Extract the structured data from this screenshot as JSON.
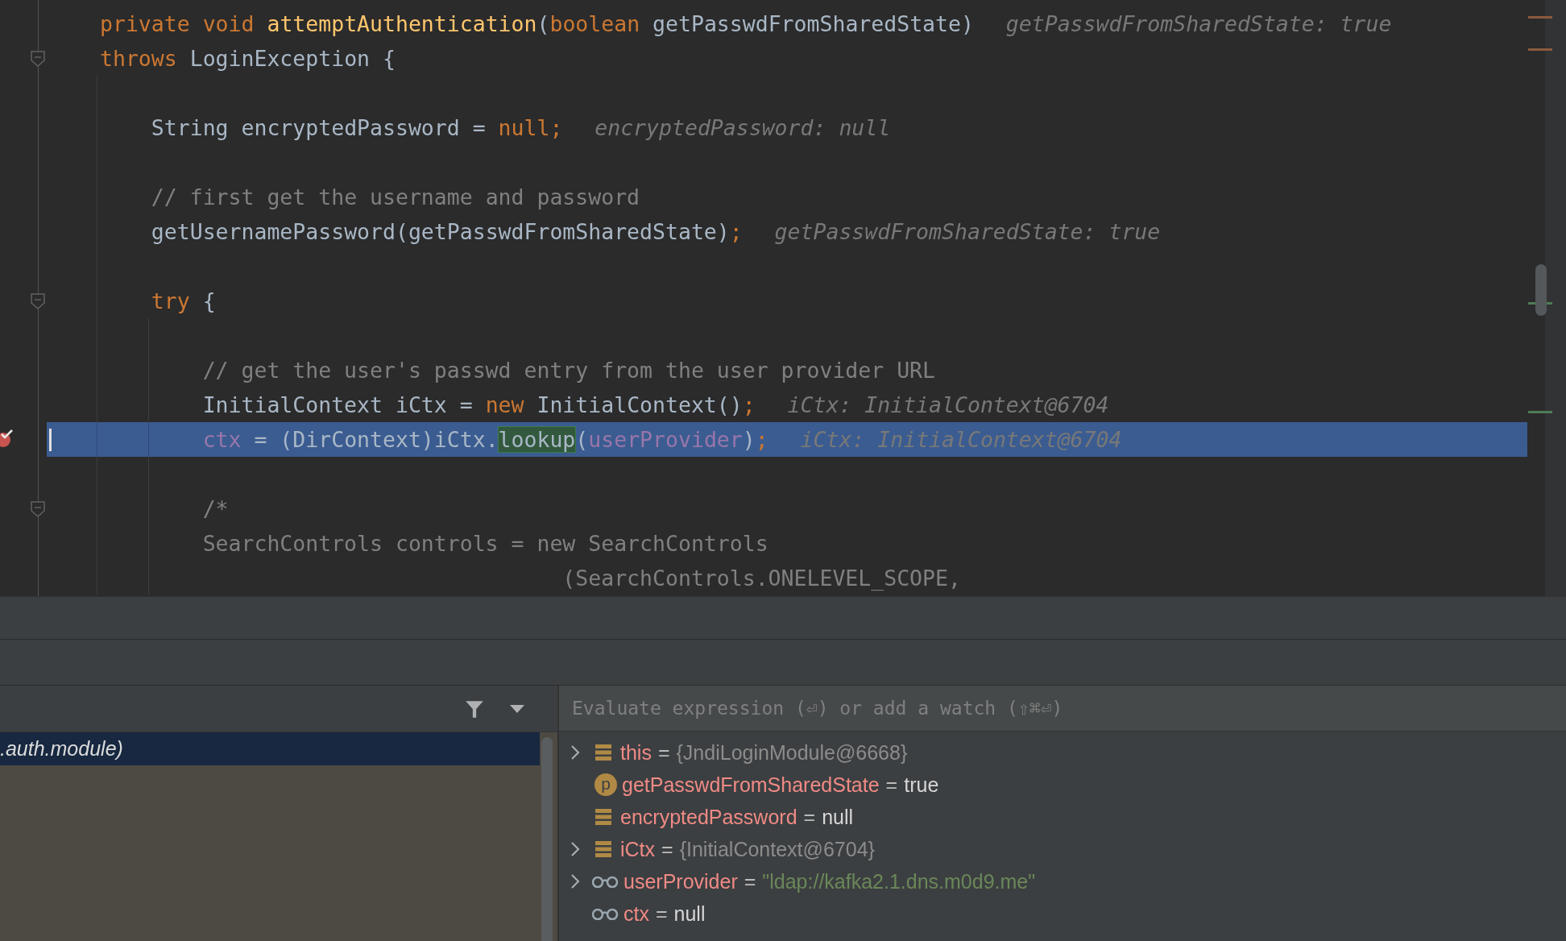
{
  "editor": {
    "lines": [
      {
        "kind": "code",
        "fold": false,
        "selected": false,
        "breakpoint": false,
        "tokens": [
          {
            "text": "private void ",
            "kind": "keyword"
          },
          {
            "text": "attemptAuthentication",
            "kind": "method"
          },
          {
            "text": "(",
            "kind": "plain"
          },
          {
            "text": "boolean ",
            "kind": "keyword"
          },
          {
            "text": "getPasswdFromSharedState)",
            "kind": "plain"
          },
          {
            "text": "getPasswdFromSharedState: true",
            "kind": "hint"
          }
        ]
      },
      {
        "kind": "code",
        "fold": true,
        "selected": false,
        "breakpoint": false,
        "tokens": [
          {
            "text": "throws ",
            "kind": "keyword"
          },
          {
            "text": "LoginException {",
            "kind": "plain"
          }
        ],
        "children": [
          {
            "kind": "blank"
          },
          {
            "kind": "code",
            "fold": false,
            "selected": false,
            "breakpoint": false,
            "tokens": [
              {
                "text": "String encryptedPassword = ",
                "kind": "plain"
              },
              {
                "text": "null;",
                "kind": "keyword"
              },
              {
                "text": "encryptedPassword: null",
                "kind": "hint"
              }
            ]
          },
          {
            "kind": "blank"
          },
          {
            "kind": "code",
            "fold": false,
            "selected": false,
            "breakpoint": false,
            "tokens": [
              {
                "text": "// first get the username and password",
                "kind": "comment"
              }
            ]
          },
          {
            "kind": "code",
            "fold": false,
            "selected": false,
            "breakpoint": false,
            "tokens": [
              {
                "text": "getUsernamePassword(getPasswdFromSharedState)",
                "kind": "plain"
              },
              {
                "text": ";",
                "kind": "keyword"
              },
              {
                "text": "getPasswdFromSharedState: true",
                "kind": "hint"
              }
            ]
          },
          {
            "kind": "blank"
          },
          {
            "kind": "code",
            "fold": true,
            "selected": false,
            "breakpoint": false,
            "tokens": [
              {
                "text": "try ",
                "kind": "keyword"
              },
              {
                "text": "{",
                "kind": "plain"
              }
            ],
            "children": [
              {
                "kind": "blank"
              },
              {
                "kind": "code",
                "fold": false,
                "selected": false,
                "breakpoint": false,
                "tokens": [
                  {
                    "text": "// get the user's passwd entry from the user provider URL",
                    "kind": "comment"
                  }
                ]
              },
              {
                "kind": "code",
                "fold": false,
                "selected": false,
                "breakpoint": false,
                "tokens": [
                  {
                    "text": "InitialContext iCtx = ",
                    "kind": "plain"
                  },
                  {
                    "text": "new ",
                    "kind": "keyword"
                  },
                  {
                    "text": "InitialContext()",
                    "kind": "plain"
                  },
                  {
                    "text": ";",
                    "kind": "keyword"
                  },
                  {
                    "text": "iCtx: InitialContext@6704",
                    "kind": "hint"
                  }
                ]
              },
              {
                "kind": "code",
                "fold": false,
                "selected": true,
                "breakpoint": true,
                "tokens": [
                  {
                    "text": "ctx",
                    "kind": "field"
                  },
                  {
                    "text": " = (DirContext)iCtx.",
                    "kind": "plain"
                  },
                  {
                    "text": "lookup",
                    "kind": "match"
                  },
                  {
                    "text": "(",
                    "kind": "plain"
                  },
                  {
                    "text": "userProvider",
                    "kind": "field"
                  },
                  {
                    "text": ")",
                    "kind": "plain"
                  },
                  {
                    "text": ";",
                    "kind": "keyword"
                  },
                  {
                    "text": "iCtx: InitialContext@6704",
                    "kind": "hint"
                  }
                ]
              },
              {
                "kind": "blank"
              },
              {
                "kind": "code",
                "fold": true,
                "selected": false,
                "breakpoint": false,
                "tokens": [
                  {
                    "text": "/*",
                    "kind": "comment"
                  }
                ]
              },
              {
                "kind": "code",
                "fold": false,
                "selected": false,
                "breakpoint": false,
                "tokens": [
                  {
                    "text": "SearchControls controls = new SearchControls",
                    "kind": "comment"
                  }
                ]
              },
              {
                "kind": "code",
                "fold": false,
                "selected": false,
                "breakpoint": false,
                "tokens": [
                  {
                    "text": "                            (SearchControls.ONELEVEL_SCOPE,",
                    "kind": "comment"
                  }
                ]
              }
            ]
          }
        ]
      }
    ]
  },
  "frames": {
    "items": [
      {
        "label": ".auth.module)",
        "selected": true
      }
    ]
  },
  "variables": {
    "placeholder": "Evaluate expression (⏎) or add a watch (⇧⌘⏎)",
    "items": [
      {
        "kind": "field",
        "expandable": true,
        "name": "this",
        "operator": "=",
        "value": "{JndiLoginModule@6668}",
        "color": "#8c8c8c"
      },
      {
        "kind": "param",
        "icon_letter": "p",
        "expandable": false,
        "name": "getPasswdFromSharedState",
        "operator": "=",
        "value": "true",
        "color": "#d6d6d6"
      },
      {
        "kind": "field",
        "expandable": false,
        "name": "encryptedPassword",
        "operator": "=",
        "value": "null",
        "color": "#d6d6d6"
      },
      {
        "kind": "field",
        "expandable": true,
        "name": "iCtx",
        "operator": "=",
        "value": "{InitialContext@6704}",
        "color": "#8c8c8c"
      },
      {
        "kind": "watch",
        "expandable": true,
        "name": "userProvider",
        "operator": "=",
        "value": "\"ldap://kafka2.1.dns.m0d9.me\"",
        "color": "#6a8759"
      },
      {
        "kind": "watch",
        "expandable": false,
        "name": "ctx",
        "operator": "=",
        "value": "null",
        "color": "#d6d6d6"
      }
    ]
  }
}
